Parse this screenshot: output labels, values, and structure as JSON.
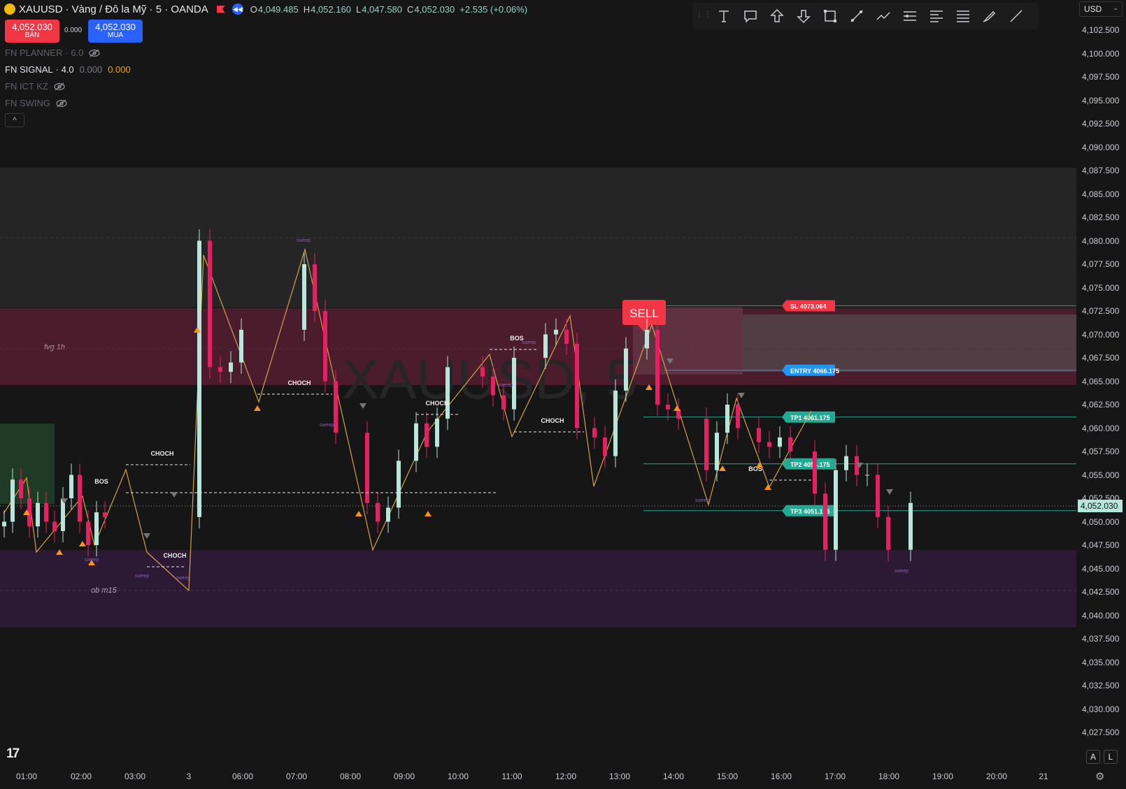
{
  "header": {
    "symbol": "XAUUSD",
    "description": "· Vàng / Đô la Mỹ · 5 · OANDA",
    "open_label": "O",
    "open": "4,049.485",
    "high_label": "H",
    "high": "4,052.160",
    "low_label": "L",
    "low": "4,047.580",
    "close_label": "C",
    "close": "4,052.030",
    "change": "+2.535 (+0.06%)"
  },
  "trade": {
    "sell_price": "4,052.030",
    "sell_label": "BÁN",
    "spread": "0.000",
    "buy_price": "4,052.030",
    "buy_label": "MUA"
  },
  "indicators": [
    {
      "name": "FN PLANNER",
      "value": "· 6.0",
      "hidden": true
    },
    {
      "name": "FN SIGNAL",
      "value": "· 4.0",
      "v1": "0.000",
      "v2": "0.000",
      "hidden": false
    },
    {
      "name": "FN ICT KZ",
      "hidden": true
    },
    {
      "name": "FN SWING",
      "hidden": true
    }
  ],
  "collapse_glyph": "^",
  "toolbar_icons": [
    "text-icon",
    "callout-icon",
    "arrow-up-icon",
    "arrow-down-icon",
    "rectangle-icon",
    "trend-line-icon",
    "path-icon",
    "fib-icon",
    "fib-channel-icon",
    "parallel-channel-icon",
    "brush-icon",
    "ray-icon"
  ],
  "currency": "USD",
  "price_ticks": [
    "4,102.500",
    "4,100.000",
    "4,097.500",
    "4,095.000",
    "4,092.500",
    "4,090.000",
    "4,087.500",
    "4,085.000",
    "4,082.500",
    "4,080.000",
    "4,077.500",
    "4,075.000",
    "4,072.500",
    "4,070.000",
    "4,067.500",
    "4,065.000",
    "4,062.500",
    "4,060.000",
    "4,057.500",
    "4,055.000",
    "4,052.500",
    "4,050.000",
    "4,047.500",
    "4,045.000",
    "4,042.500",
    "4,040.000",
    "4,037.500",
    "4,035.000",
    "4,032.500",
    "4,030.000",
    "4,027.500"
  ],
  "last_price": "4,052.030",
  "time_labels": [
    "01:00",
    "02:00",
    "03:00",
    "3",
    "06:00",
    "07:00",
    "08:00",
    "09:00",
    "10:00",
    "11:00",
    "12:00",
    "13:00",
    "14:00",
    "15:00",
    "16:00",
    "17:00",
    "18:00",
    "19:00",
    "20:00",
    "21"
  ],
  "corner_buttons": [
    "A",
    "L"
  ],
  "watermark": "XAUUSD, 5",
  "tv_logo": "17",
  "zones": [
    {
      "label": "fvg 1h",
      "color": "#4a1c2c"
    },
    {
      "label": "ob m15",
      "color": "#2c1a35"
    },
    {
      "label": "",
      "color": "#252525"
    }
  ],
  "signal": {
    "sell": "SELL",
    "sl": "SL 4073.064",
    "entry": "ENTRY 4066.175",
    "tp1": "TP1 4061.175",
    "tp2": "TP2 4056.175",
    "tp3": "TP3 4051.175",
    "sl_color": "#f23645",
    "entry_color": "#2196f3",
    "tp_color": "#22ab94"
  },
  "structure_labels": [
    "BOS",
    "CHOCH",
    "CHOCH",
    "CHOCH",
    "CHOCH",
    "BOS",
    "CHOCH",
    "BOS"
  ],
  "sweep_label": "sweep",
  "colors": {
    "up": "#b8e6da",
    "down": "#e91e63",
    "zigzag": "#d4a14a",
    "triangle_up": "#f7931a",
    "triangle_down": "#777777"
  },
  "chart_data": {
    "type": "candlestick",
    "symbol": "XAUUSD",
    "timeframe": "5",
    "ylim": [
      4026.0,
      4104.0
    ],
    "x": [
      "00:45",
      "01:00",
      "01:15",
      "01:30",
      "01:45",
      "02:00",
      "02:15",
      "02:30",
      "02:45",
      "03:00",
      "03:15",
      "03:30",
      "03:45",
      "04:00",
      "06:00",
      "06:15",
      "06:30",
      "06:45",
      "07:00",
      "07:15",
      "07:30",
      "07:45",
      "08:00",
      "08:15",
      "08:30",
      "08:45",
      "09:00",
      "09:15",
      "09:30",
      "09:45",
      "10:00",
      "10:15",
      "10:30",
      "10:45",
      "11:00",
      "11:15",
      "11:30",
      "11:45",
      "12:00",
      "12:15",
      "12:30",
      "12:45",
      "13:00",
      "13:15",
      "13:30",
      "13:45",
      "14:00",
      "14:15",
      "14:30",
      "14:45",
      "15:00",
      "15:15",
      "15:30",
      "15:45",
      "16:00",
      "16:15",
      "16:30",
      "16:45",
      "17:00",
      "17:15",
      "17:30",
      "17:45",
      "18:00"
    ],
    "close": [
      4050.0,
      4054.5,
      4052.5,
      4049.5,
      4052.0,
      4050.0,
      4049.0,
      4052.5,
      4055.0,
      4050.0,
      4047.5,
      4051.0,
      4050.5,
      4080.0,
      4066.5,
      4066.0,
      4067.0,
      4070.5,
      4077.5,
      4072.5,
      4065.0,
      4059.5,
      4052.0,
      4050.0,
      4051.5,
      4056.5,
      4060.5,
      4058.0,
      4061.0,
      4066.5,
      4065.5,
      4063.5,
      4062.0,
      4067.5,
      4070.0,
      4070.5,
      4069.0,
      4060.0,
      4059.0,
      4057.0,
      4064.0,
      4068.5,
      4070.5,
      4062.5,
      4062.0,
      4061.0,
      4055.5,
      4059.5,
      4062.5,
      4060.0,
      4058.5,
      4058.0,
      4059.0,
      4057.5,
      4053.0,
      4047.0,
      4055.5,
      4057.0,
      4055.0,
      4055.0,
      4050.5,
      4047.0,
      4052.0
    ]
  }
}
